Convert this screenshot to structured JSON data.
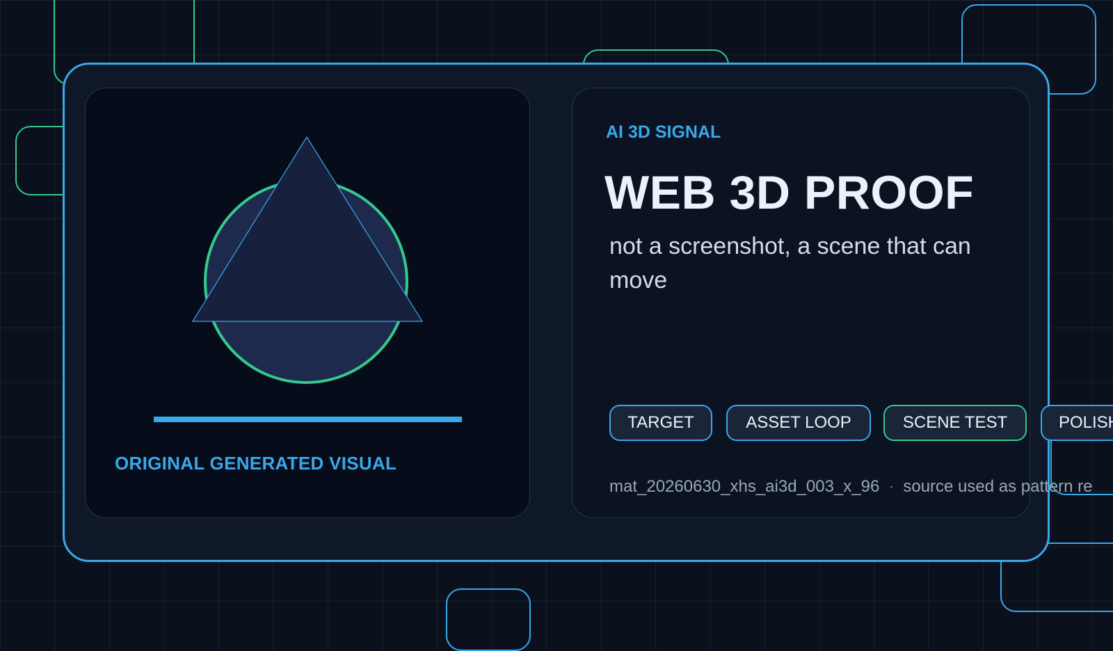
{
  "visual": {
    "caption": "ORIGINAL GENERATED VISUAL",
    "shapes": [
      "circle-shape",
      "triangle-shape",
      "progress-bar"
    ]
  },
  "info": {
    "eyebrow": "AI 3D SIGNAL",
    "headline": "WEB 3D PROOF",
    "subtitle": "not a screenshot, a scene that can move",
    "tags": [
      "TARGET",
      "ASSET LOOP",
      "SCENE TEST",
      "POLISH"
    ],
    "footer": {
      "id": "mat_20260630_xhs_ai3d_003_x_96",
      "separator": "·",
      "note": "source used as pattern re"
    }
  },
  "colors": {
    "background": "#0a111c",
    "card": "#0f1829",
    "panel": "#060c19",
    "accent_blue": "#3aa8ea",
    "accent_green": "#34c98e",
    "shape_fill": "#1e2a4d",
    "headline": "#eaf2fc",
    "muted": "#9aa6b6"
  }
}
